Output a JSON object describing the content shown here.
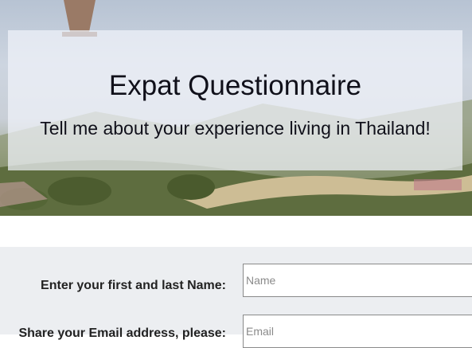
{
  "header": {
    "title": "Expat Questionnaire",
    "subtitle": "Tell me about your experience living in Thailand!"
  },
  "form": {
    "name_label": "Enter your first and last Name:",
    "name_placeholder": "Name",
    "email_label": "Share your Email address, please:",
    "email_placeholder": "Email"
  },
  "colors": {
    "panel": "#f0f3fa",
    "form_bg": "#eceef1",
    "text": "#10101a"
  }
}
